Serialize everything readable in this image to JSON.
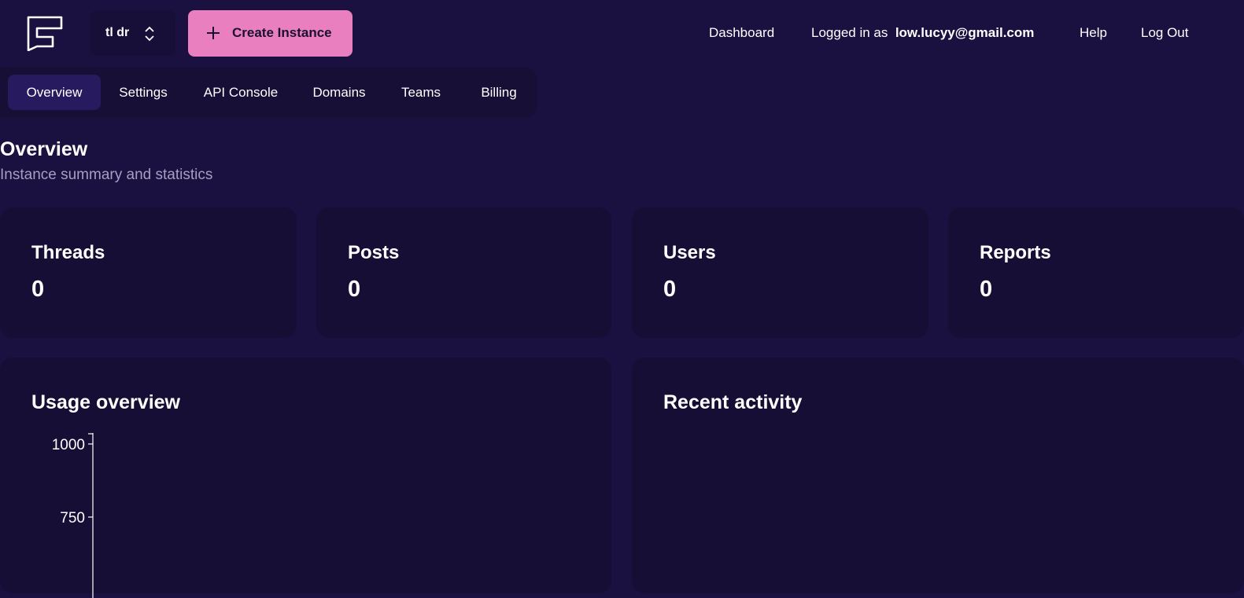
{
  "header": {
    "instance_name": "tl dr",
    "create_label": "Create Instance",
    "dashboard_label": "Dashboard",
    "logged_in_prefix": "Logged in as",
    "user_email": "low.lucyy@gmail.com",
    "help_label": "Help",
    "logout_label": "Log Out"
  },
  "tabs": [
    {
      "label": "Overview",
      "active": true
    },
    {
      "label": "Settings",
      "active": false
    },
    {
      "label": "API Console",
      "active": false
    },
    {
      "label": "Domains",
      "active": false
    },
    {
      "label": "Teams",
      "active": false
    },
    {
      "label": "Billing",
      "active": false
    }
  ],
  "page": {
    "title": "Overview",
    "subtitle": "Instance summary and statistics"
  },
  "stats": [
    {
      "label": "Threads",
      "value": "0"
    },
    {
      "label": "Posts",
      "value": "0"
    },
    {
      "label": "Users",
      "value": "0"
    },
    {
      "label": "Reports",
      "value": "0"
    }
  ],
  "usage": {
    "title": "Usage overview"
  },
  "activity": {
    "title": "Recent activity"
  },
  "chart_data": {
    "type": "line",
    "y_ticks": [
      1000,
      750
    ],
    "series": []
  },
  "colors": {
    "background": "#1a1140",
    "card": "#170e36",
    "accent": "#e97fbf",
    "active_tab": "#271a5e"
  }
}
